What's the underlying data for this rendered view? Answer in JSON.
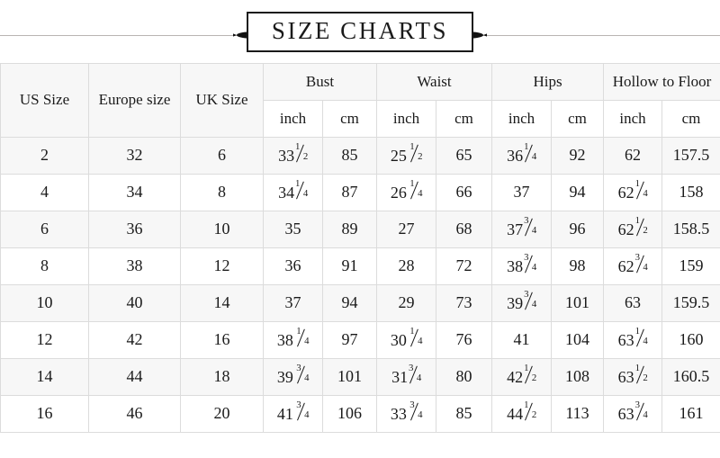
{
  "title": {
    "text": "SIZE CHARTS",
    "ornament_left": "leaf-fleuron-left-icon",
    "ornament_right": "leaf-fleuron-right-icon"
  },
  "colors": {
    "border": "#dcdcdc",
    "shade_row": "#f7f7f7",
    "text": "#1a1a1a",
    "rule": "#b9b5b2"
  },
  "table": {
    "group_headers": [
      {
        "label": "US Size",
        "rowspan": 2
      },
      {
        "label": "Europe size",
        "rowspan": 2
      },
      {
        "label": "UK Size",
        "rowspan": 2
      },
      {
        "label": "Bust",
        "colspan": 2
      },
      {
        "label": "Waist",
        "colspan": 2
      },
      {
        "label": "Hips",
        "colspan": 2
      },
      {
        "label": "Hollow to Floor",
        "colspan": 2
      }
    ],
    "unit_headers": [
      "inch",
      "cm",
      "inch",
      "cm",
      "inch",
      "cm",
      "inch",
      "cm"
    ],
    "rows": [
      {
        "us": "2",
        "eu": "32",
        "uk": "6",
        "bust_inch": {
          "whole": "33",
          "num": "1",
          "den": "2",
          "spaced": false
        },
        "bust_cm": "85",
        "waist_inch": {
          "whole": "25",
          "num": "1",
          "den": "2",
          "spaced": true
        },
        "waist_cm": "65",
        "hips_inch": {
          "whole": "36",
          "num": "1",
          "den": "4",
          "spaced": false
        },
        "hips_cm": "92",
        "hollow_inch": {
          "whole": "62",
          "num": "",
          "den": "",
          "spaced": false
        },
        "hollow_cm": "157.5"
      },
      {
        "us": "4",
        "eu": "34",
        "uk": "8",
        "bust_inch": {
          "whole": "34",
          "num": "1",
          "den": "4",
          "spaced": false
        },
        "bust_cm": "87",
        "waist_inch": {
          "whole": "26",
          "num": "1",
          "den": "4",
          "spaced": true
        },
        "waist_cm": "66",
        "hips_inch": {
          "whole": "37",
          "num": "",
          "den": "",
          "spaced": false
        },
        "hips_cm": "94",
        "hollow_inch": {
          "whole": "62",
          "num": "1",
          "den": "4",
          "spaced": false
        },
        "hollow_cm": "158"
      },
      {
        "us": "6",
        "eu": "36",
        "uk": "10",
        "bust_inch": {
          "whole": "35",
          "num": "",
          "den": "",
          "spaced": false
        },
        "bust_cm": "89",
        "waist_inch": {
          "whole": "27",
          "num": "",
          "den": "",
          "spaced": false
        },
        "waist_cm": "68",
        "hips_inch": {
          "whole": "37",
          "num": "3",
          "den": "4",
          "spaced": false
        },
        "hips_cm": "96",
        "hollow_inch": {
          "whole": "62",
          "num": "1",
          "den": "2",
          "spaced": false
        },
        "hollow_cm": "158.5"
      },
      {
        "us": "8",
        "eu": "38",
        "uk": "12",
        "bust_inch": {
          "whole": "36",
          "num": "",
          "den": "",
          "spaced": false
        },
        "bust_cm": "91",
        "waist_inch": {
          "whole": "28",
          "num": "",
          "den": "",
          "spaced": false
        },
        "waist_cm": "72",
        "hips_inch": {
          "whole": "38",
          "num": "3",
          "den": "4",
          "spaced": false
        },
        "hips_cm": "98",
        "hollow_inch": {
          "whole": "62",
          "num": "3",
          "den": "4",
          "spaced": false
        },
        "hollow_cm": "159"
      },
      {
        "us": "10",
        "eu": "40",
        "uk": "14",
        "bust_inch": {
          "whole": "37",
          "num": "",
          "den": "",
          "spaced": false
        },
        "bust_cm": "94",
        "waist_inch": {
          "whole": "29",
          "num": "",
          "den": "",
          "spaced": false
        },
        "waist_cm": "73",
        "hips_inch": {
          "whole": "39",
          "num": "3",
          "den": "4",
          "spaced": false
        },
        "hips_cm": "101",
        "hollow_inch": {
          "whole": "63",
          "num": "",
          "den": "",
          "spaced": false
        },
        "hollow_cm": "159.5"
      },
      {
        "us": "12",
        "eu": "42",
        "uk": "16",
        "bust_inch": {
          "whole": "38",
          "num": "1",
          "den": "4",
          "spaced": true
        },
        "bust_cm": "97",
        "waist_inch": {
          "whole": "30",
          "num": "1",
          "den": "4",
          "spaced": true
        },
        "waist_cm": "76",
        "hips_inch": {
          "whole": "41",
          "num": "",
          "den": "",
          "spaced": false
        },
        "hips_cm": "104",
        "hollow_inch": {
          "whole": "63",
          "num": "1",
          "den": "4",
          "spaced": false
        },
        "hollow_cm": "160"
      },
      {
        "us": "14",
        "eu": "44",
        "uk": "18",
        "bust_inch": {
          "whole": "39",
          "num": "3",
          "den": "4",
          "spaced": true
        },
        "bust_cm": "101",
        "waist_inch": {
          "whole": "31",
          "num": "3",
          "den": "4",
          "spaced": false
        },
        "waist_cm": "80",
        "hips_inch": {
          "whole": "42",
          "num": "1",
          "den": "2",
          "spaced": false
        },
        "hips_cm": "108",
        "hollow_inch": {
          "whole": "63",
          "num": "1",
          "den": "2",
          "spaced": false
        },
        "hollow_cm": "160.5"
      },
      {
        "us": "16",
        "eu": "46",
        "uk": "20",
        "bust_inch": {
          "whole": "41",
          "num": "3",
          "den": "4",
          "spaced": true
        },
        "bust_cm": "106",
        "waist_inch": {
          "whole": "33",
          "num": "3",
          "den": "4",
          "spaced": true
        },
        "waist_cm": "85",
        "hips_inch": {
          "whole": "44",
          "num": "1",
          "den": "2",
          "spaced": false
        },
        "hips_cm": "113",
        "hollow_inch": {
          "whole": "63",
          "num": "3",
          "den": "4",
          "spaced": false
        },
        "hollow_cm": "161"
      }
    ]
  }
}
